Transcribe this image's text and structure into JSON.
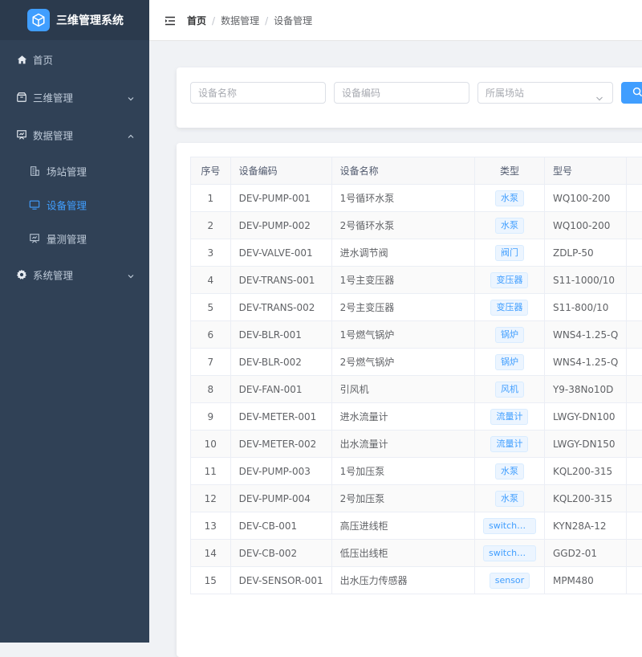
{
  "app": {
    "title": "三维管理系统"
  },
  "sidebar": {
    "items": [
      {
        "label": "首页"
      },
      {
        "label": "三维管理"
      },
      {
        "label": "数据管理"
      },
      {
        "label": "系统管理"
      }
    ],
    "sub_items": [
      {
        "label": "场站管理"
      },
      {
        "label": "设备管理"
      },
      {
        "label": "量测管理"
      }
    ]
  },
  "breadcrumb": {
    "home": "首页",
    "level1": "数据管理",
    "level2": "设备管理"
  },
  "filters": {
    "name_placeholder": "设备名称",
    "code_placeholder": "设备编码",
    "station_placeholder": "所属场站"
  },
  "table": {
    "headers": [
      "序号",
      "设备编码",
      "设备名称",
      "类型",
      "型号"
    ],
    "rows": [
      {
        "no": "1",
        "code": "DEV-PUMP-001",
        "name": "1号循环水泵",
        "type": "水泵",
        "model": "WQ100-200"
      },
      {
        "no": "2",
        "code": "DEV-PUMP-002",
        "name": "2号循环水泵",
        "type": "水泵",
        "model": "WQ100-200"
      },
      {
        "no": "3",
        "code": "DEV-VALVE-001",
        "name": "进水调节阀",
        "type": "阀门",
        "model": "ZDLP-50"
      },
      {
        "no": "4",
        "code": "DEV-TRANS-001",
        "name": "1号主变压器",
        "type": "变压器",
        "model": "S11-1000/10"
      },
      {
        "no": "5",
        "code": "DEV-TRANS-002",
        "name": "2号主变压器",
        "type": "变压器",
        "model": "S11-800/10"
      },
      {
        "no": "6",
        "code": "DEV-BLR-001",
        "name": "1号燃气锅炉",
        "type": "锅炉",
        "model": "WNS4-1.25-Q"
      },
      {
        "no": "7",
        "code": "DEV-BLR-002",
        "name": "2号燃气锅炉",
        "type": "锅炉",
        "model": "WNS4-1.25-Q"
      },
      {
        "no": "8",
        "code": "DEV-FAN-001",
        "name": "引风机",
        "type": "风机",
        "model": "Y9-38No10D"
      },
      {
        "no": "9",
        "code": "DEV-METER-001",
        "name": "进水流量计",
        "type": "流量计",
        "model": "LWGY-DN100"
      },
      {
        "no": "10",
        "code": "DEV-METER-002",
        "name": "出水流量计",
        "type": "流量计",
        "model": "LWGY-DN150"
      },
      {
        "no": "11",
        "code": "DEV-PUMP-003",
        "name": "1号加压泵",
        "type": "水泵",
        "model": "KQL200-315"
      },
      {
        "no": "12",
        "code": "DEV-PUMP-004",
        "name": "2号加压泵",
        "type": "水泵",
        "model": "KQL200-315"
      },
      {
        "no": "13",
        "code": "DEV-CB-001",
        "name": "高压进线柜",
        "type": "switchgear",
        "model": "KYN28A-12"
      },
      {
        "no": "14",
        "code": "DEV-CB-002",
        "name": "低压出线柜",
        "type": "switchgear",
        "model": "GGD2-01"
      },
      {
        "no": "15",
        "code": "DEV-SENSOR-001",
        "name": "出水压力传感器",
        "type": "sensor",
        "model": "MPM480"
      }
    ]
  },
  "colors": {
    "sidebar_bg": "#304156",
    "accent": "#409eff",
    "menu_text": "#bfcbd9"
  }
}
